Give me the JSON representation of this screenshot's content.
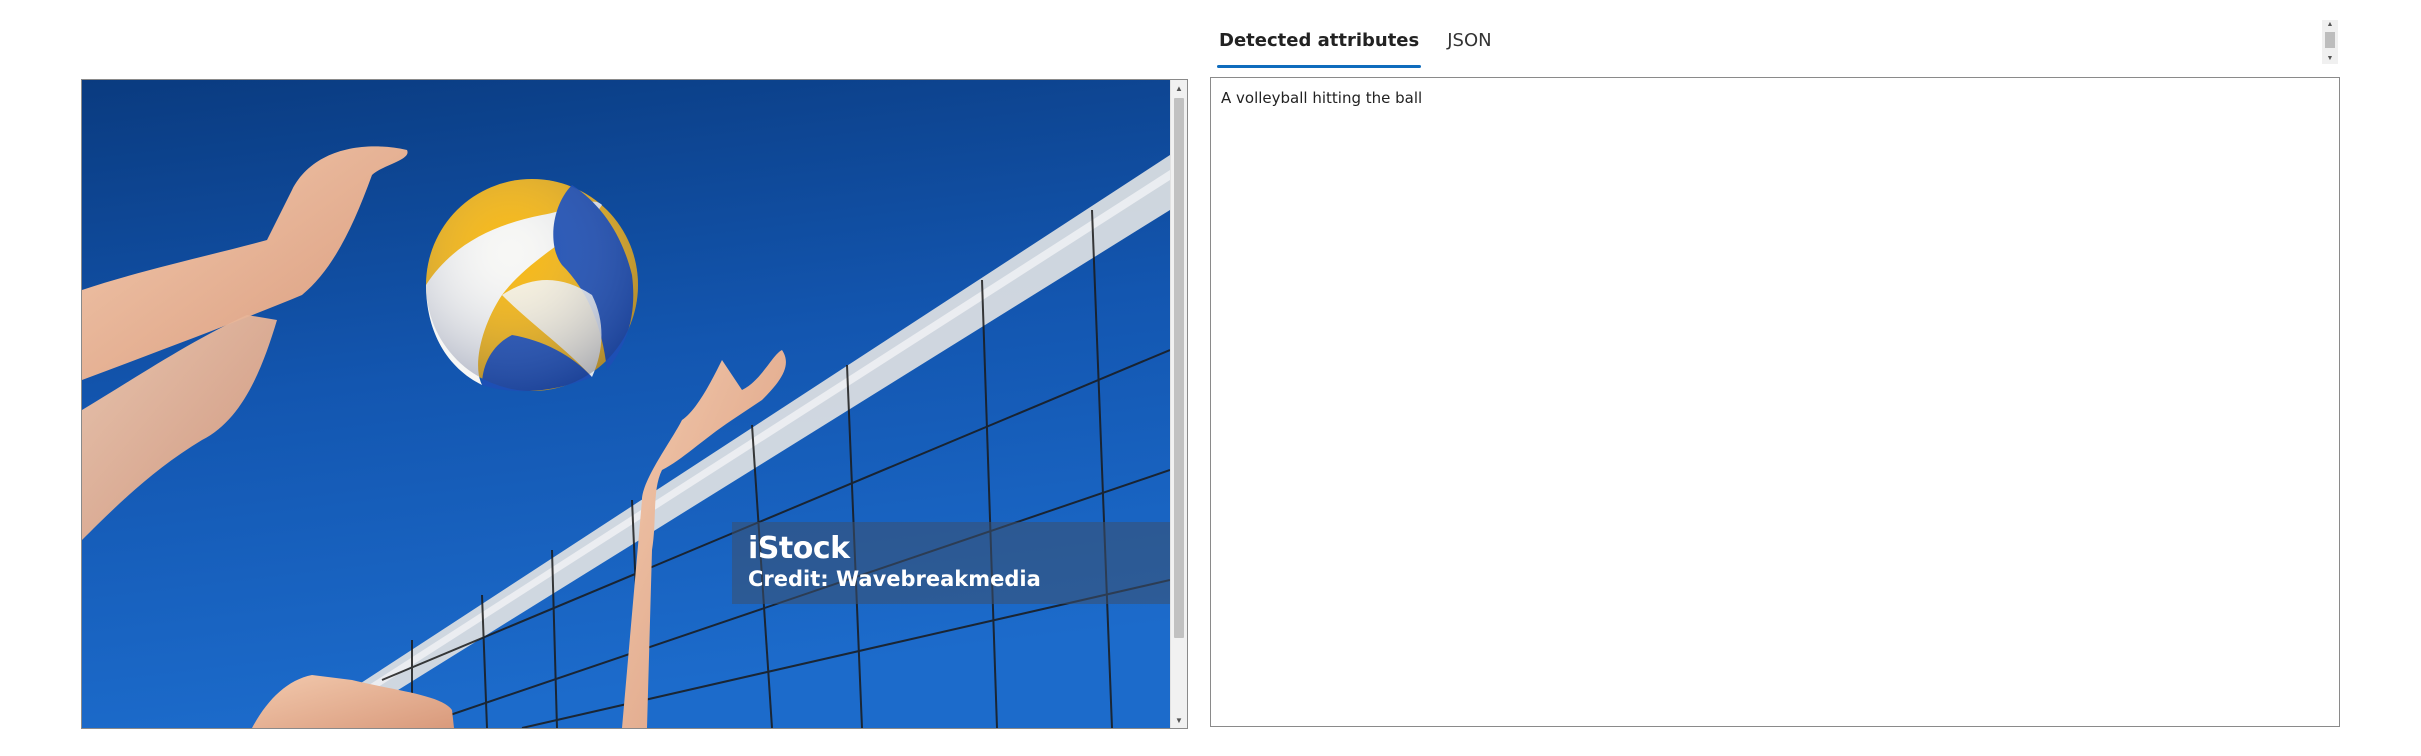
{
  "tabs": [
    {
      "label": "Detected attributes",
      "active": true
    },
    {
      "label": "JSON",
      "active": false
    }
  ],
  "image": {
    "subject": "volleyball-over-net-photo",
    "watermark_brand": "iStock",
    "watermark_credit": "Credit: Wavebreakmedia"
  },
  "attributes": {
    "text": "A volleyball hitting the ball"
  },
  "colors": {
    "accent": "#0f6cbd",
    "sky_top": "#0a3f86",
    "sky_bottom": "#1a66c4",
    "ball_yellow": "#f6b713",
    "ball_blue": "#1d4fb5"
  }
}
